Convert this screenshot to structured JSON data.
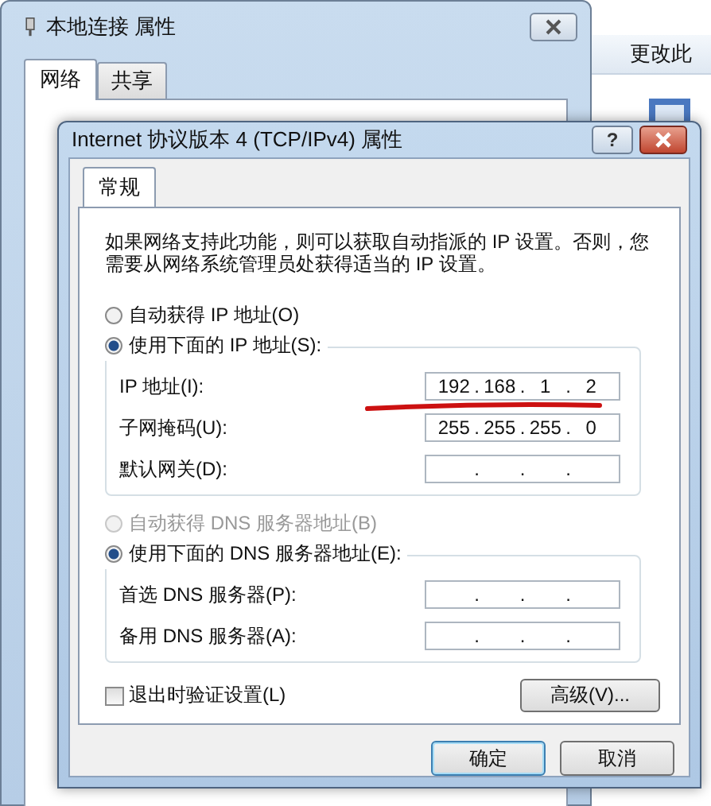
{
  "background_window": {
    "title": "本地连接 属性",
    "tabs": [
      {
        "label": "网络",
        "selected": true
      },
      {
        "label": "共享",
        "selected": false
      }
    ]
  },
  "background_explorer": {
    "toolbar_text": "更改此"
  },
  "dialog": {
    "title": "Internet 协议版本 4 (TCP/IPv4) 属性",
    "help_button": "?",
    "tabs": [
      {
        "label": "常规",
        "selected": true
      }
    ],
    "description": "如果网络支持此功能，则可以获取自动指派的 IP 设置。否则，您需要从网络系统管理员处获得适当的 IP 设置。",
    "ip_mode": [
      {
        "label": "自动获得 IP 地址(O)",
        "selected": false,
        "disabled": false
      },
      {
        "label": "使用下面的 IP 地址(S):",
        "selected": true,
        "disabled": false
      }
    ],
    "ip_fields": [
      {
        "label": "IP 地址(I):",
        "octets": [
          "192",
          "168",
          "1",
          "2"
        ],
        "dots": [
          ".",
          ".",
          "."
        ]
      },
      {
        "label": "子网掩码(U):",
        "octets": [
          "255",
          "255",
          "255",
          "0"
        ],
        "dots": [
          ".",
          ".",
          "."
        ]
      },
      {
        "label": "默认网关(D):",
        "dots": [
          ".",
          ".",
          "."
        ]
      }
    ],
    "dns_mode": [
      {
        "label": "自动获得 DNS 服务器地址(B)",
        "selected": false,
        "disabled": true
      },
      {
        "label": "使用下面的 DNS 服务器地址(E):",
        "selected": true,
        "disabled": false
      }
    ],
    "dns_fields": [
      {
        "label": "首选 DNS 服务器(P):",
        "dots": [
          ".",
          ".",
          "."
        ]
      },
      {
        "label": "备用 DNS 服务器(A):",
        "dots": [
          ".",
          ".",
          "."
        ]
      }
    ],
    "validate_checkbox": {
      "label": "退出时验证设置(L)",
      "checked": false
    },
    "advanced_button": "高级(V)...",
    "buttons": [
      "确定",
      "取消"
    ]
  }
}
